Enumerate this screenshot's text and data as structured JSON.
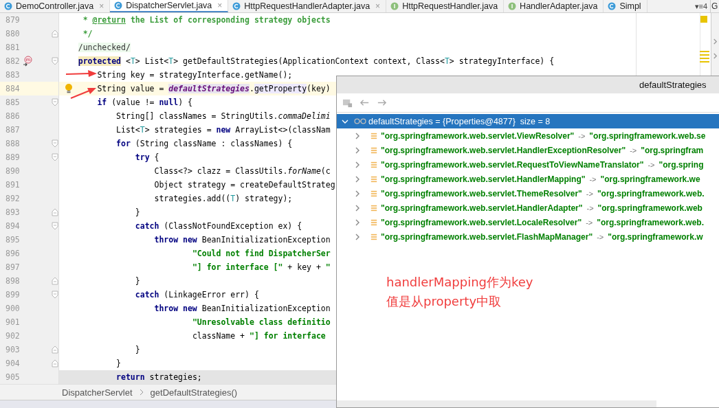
{
  "tabs": [
    {
      "label": "DemoController.java",
      "kind": "class",
      "selected": false,
      "close": "×"
    },
    {
      "label": "DispatcherServlet.java",
      "kind": "class",
      "selected": true,
      "close": "×"
    },
    {
      "label": "HttpRequestHandlerAdapter.java",
      "kind": "class",
      "selected": false,
      "close": "×"
    },
    {
      "label": "HttpRequestHandler.java",
      "kind": "interface",
      "selected": false
    },
    {
      "label": "HandlerAdapter.java",
      "kind": "interface",
      "selected": false
    },
    {
      "label": "Simpl",
      "kind": "class",
      "selected": false
    }
  ],
  "tab_overflow": "▾≡4",
  "side_tab": "G",
  "editor": {
    "lines": [
      {
        "number": "879",
        "tokens": [
          {
            "text": "     * ",
            "kind": "doc"
          },
          {
            "text": "@return",
            "kind": "doctag"
          },
          {
            "text": " the List of corresponding strategy objects",
            "kind": "doc"
          }
        ]
      },
      {
        "number": "880",
        "fold": {
          "kind": "end"
        },
        "tokens": [
          {
            "text": "     */",
            "kind": "doc"
          }
        ]
      },
      {
        "number": "881",
        "tokens": [
          {
            "text": "    /unchecked/",
            "kind": "suppressed"
          }
        ]
      },
      {
        "number": "882",
        "fold": {
          "kind": "start"
        },
        "gutter_icon": {
          "kind": "method"
        },
        "tokens": [
          {
            "text": "    protected",
            "kind": "keyword-hl"
          },
          {
            "text": " <",
            "kind": "plain"
          },
          {
            "text": "T",
            "kind": "typeparam"
          },
          {
            "text": "> List<",
            "kind": "plain"
          },
          {
            "text": "T",
            "kind": "typeparam"
          },
          {
            "text": "> getDefaultStrategies(ApplicationContext context, Class<",
            "kind": "plain"
          },
          {
            "text": "T",
            "kind": "typeparam"
          },
          {
            "text": "> strategyInterface) {",
            "kind": "plain"
          }
        ]
      },
      {
        "number": "883",
        "tokens": [
          {
            "text": "        String key = strategyInterface.getName();",
            "kind": "plain"
          }
        ]
      },
      {
        "number": "884",
        "highlight": {
          "kind": "caret"
        },
        "gutter_icon": {
          "kind": "bulb"
        },
        "tokens": [
          {
            "text": "        String value = ",
            "kind": "plain"
          },
          {
            "text": "defaultStrategies",
            "kind": "field"
          },
          {
            "text": ".",
            "kind": "plain"
          },
          {
            "text": "getProperty",
            "kind": "call-hl"
          },
          {
            "text": "(key)",
            "kind": "plain"
          }
        ]
      },
      {
        "number": "885",
        "fold": {
          "kind": "start"
        },
        "tokens": [
          {
            "text": "        if",
            "kind": "keyword"
          },
          {
            "text": " (value != ",
            "kind": "plain"
          },
          {
            "text": "null",
            "kind": "keyword"
          },
          {
            "text": ") {",
            "kind": "plain"
          }
        ]
      },
      {
        "number": "886",
        "tokens": [
          {
            "text": "            String[] classNames = StringUtils.",
            "kind": "plain"
          },
          {
            "text": "commaDelimi",
            "kind": "static"
          }
        ]
      },
      {
        "number": "887",
        "tokens": [
          {
            "text": "            List<",
            "kind": "plain"
          },
          {
            "text": "T",
            "kind": "typeparam"
          },
          {
            "text": "> strategies = ",
            "kind": "plain"
          },
          {
            "text": "new",
            "kind": "keyword"
          },
          {
            "text": " ArrayList<>(classNam",
            "kind": "plain"
          }
        ]
      },
      {
        "number": "888",
        "fold": {
          "kind": "start"
        },
        "tokens": [
          {
            "text": "            for",
            "kind": "keyword"
          },
          {
            "text": " (String className : classNames) {",
            "kind": "plain"
          }
        ]
      },
      {
        "number": "889",
        "fold": {
          "kind": "start"
        },
        "tokens": [
          {
            "text": "                try",
            "kind": "keyword"
          },
          {
            "text": " {",
            "kind": "plain"
          }
        ]
      },
      {
        "number": "890",
        "tokens": [
          {
            "text": "                    Class<?> clazz = ClassUtils.",
            "kind": "plain"
          },
          {
            "text": "forName",
            "kind": "static"
          },
          {
            "text": "(c",
            "kind": "plain"
          }
        ]
      },
      {
        "number": "891",
        "tokens": [
          {
            "text": "                    Object strategy = createDefaultStrateg",
            "kind": "plain"
          }
        ]
      },
      {
        "number": "892",
        "tokens": [
          {
            "text": "                    strategies.add((",
            "kind": "plain"
          },
          {
            "text": "T",
            "kind": "typeparam"
          },
          {
            "text": ") strategy);",
            "kind": "plain"
          }
        ]
      },
      {
        "number": "893",
        "fold": {
          "kind": "end"
        },
        "tokens": [
          {
            "text": "                }",
            "kind": "plain"
          }
        ]
      },
      {
        "number": "894",
        "fold": {
          "kind": "start"
        },
        "tokens": [
          {
            "text": "                catch",
            "kind": "keyword"
          },
          {
            "text": " (ClassNotFoundException ex) {",
            "kind": "plain"
          }
        ]
      },
      {
        "number": "895",
        "tokens": [
          {
            "text": "                    throw new",
            "kind": "keyword"
          },
          {
            "text": " BeanInitializationException",
            "kind": "plain"
          }
        ]
      },
      {
        "number": "896",
        "tokens": [
          {
            "text": "                            \"Could not find DispatcherSer",
            "kind": "string"
          }
        ]
      },
      {
        "number": "897",
        "tokens": [
          {
            "text": "                            \"] for interface [\"",
            "kind": "string"
          },
          {
            "text": " + key + ",
            "kind": "plain"
          },
          {
            "text": "\"",
            "kind": "string"
          }
        ]
      },
      {
        "number": "898",
        "fold": {
          "kind": "end"
        },
        "tokens": [
          {
            "text": "                }",
            "kind": "plain"
          }
        ]
      },
      {
        "number": "899",
        "fold": {
          "kind": "start"
        },
        "tokens": [
          {
            "text": "                catch",
            "kind": "keyword"
          },
          {
            "text": " (LinkageError err) {",
            "kind": "plain"
          }
        ]
      },
      {
        "number": "900",
        "tokens": [
          {
            "text": "                    throw new",
            "kind": "keyword"
          },
          {
            "text": " BeanInitializationException",
            "kind": "plain"
          }
        ]
      },
      {
        "number": "901",
        "tokens": [
          {
            "text": "                            \"Unresolvable class definitio",
            "kind": "string"
          }
        ]
      },
      {
        "number": "902",
        "tokens": [
          {
            "text": "                            className + ",
            "kind": "plain"
          },
          {
            "text": "\"] for interface",
            "kind": "string"
          }
        ]
      },
      {
        "number": "903",
        "fold": {
          "kind": "end"
        },
        "tokens": [
          {
            "text": "                }",
            "kind": "plain"
          }
        ]
      },
      {
        "number": "904",
        "fold": {
          "kind": "end"
        },
        "tokens": [
          {
            "text": "            }",
            "kind": "plain"
          }
        ]
      },
      {
        "number": "905",
        "highlight": {
          "kind": "gray"
        },
        "tokens": [
          {
            "text": "            return",
            "kind": "keyword"
          },
          {
            "text": " strategies;",
            "kind": "plain"
          }
        ]
      }
    ]
  },
  "breadcrumb": [
    "DispatcherServlet",
    "getDefaultStrategies()"
  ],
  "popup": {
    "title": "defaultStrategies",
    "root": {
      "label": "defaultStrategies = {Properties@4877}  size = 8",
      "expanded": true,
      "selected": true
    },
    "children": [
      {
        "key": "\"org.springframework.web.servlet.ViewResolver\"",
        "arrow": "->",
        "value": "\"org.springframework.web.se",
        "expanded": false,
        "selected": false
      },
      {
        "key": "\"org.springframework.web.servlet.HandlerExceptionResolver\"",
        "arrow": "->",
        "value": "\"org.springfram",
        "expanded": false,
        "selected": false
      },
      {
        "key": "\"org.springframework.web.servlet.RequestToViewNameTranslator\"",
        "arrow": "->",
        "value": "\"org.spring",
        "expanded": false,
        "selected": false
      },
      {
        "key": "\"org.springframework.web.servlet.HandlerMapping\"",
        "arrow": "->",
        "value": "\"org.springframework.we",
        "expanded": false,
        "selected": false
      },
      {
        "key": "\"org.springframework.web.servlet.ThemeResolver\"",
        "arrow": "->",
        "value": "\"org.springframework.web.",
        "expanded": false,
        "selected": false
      },
      {
        "key": "\"org.springframework.web.servlet.HandlerAdapter\"",
        "arrow": "->",
        "value": "\"org.springframework.web",
        "expanded": false,
        "selected": false
      },
      {
        "key": "\"org.springframework.web.servlet.LocaleResolver\"",
        "arrow": "->",
        "value": "\"org.springframework.web.",
        "expanded": false,
        "selected": false
      },
      {
        "key": "\"org.springframework.web.servlet.FlashMapManager\"",
        "arrow": "->",
        "value": "\"org.springframework.w",
        "expanded": false,
        "selected": false
      }
    ],
    "annotation": [
      "handlerMapping作为key",
      "值是从property中取"
    ]
  }
}
